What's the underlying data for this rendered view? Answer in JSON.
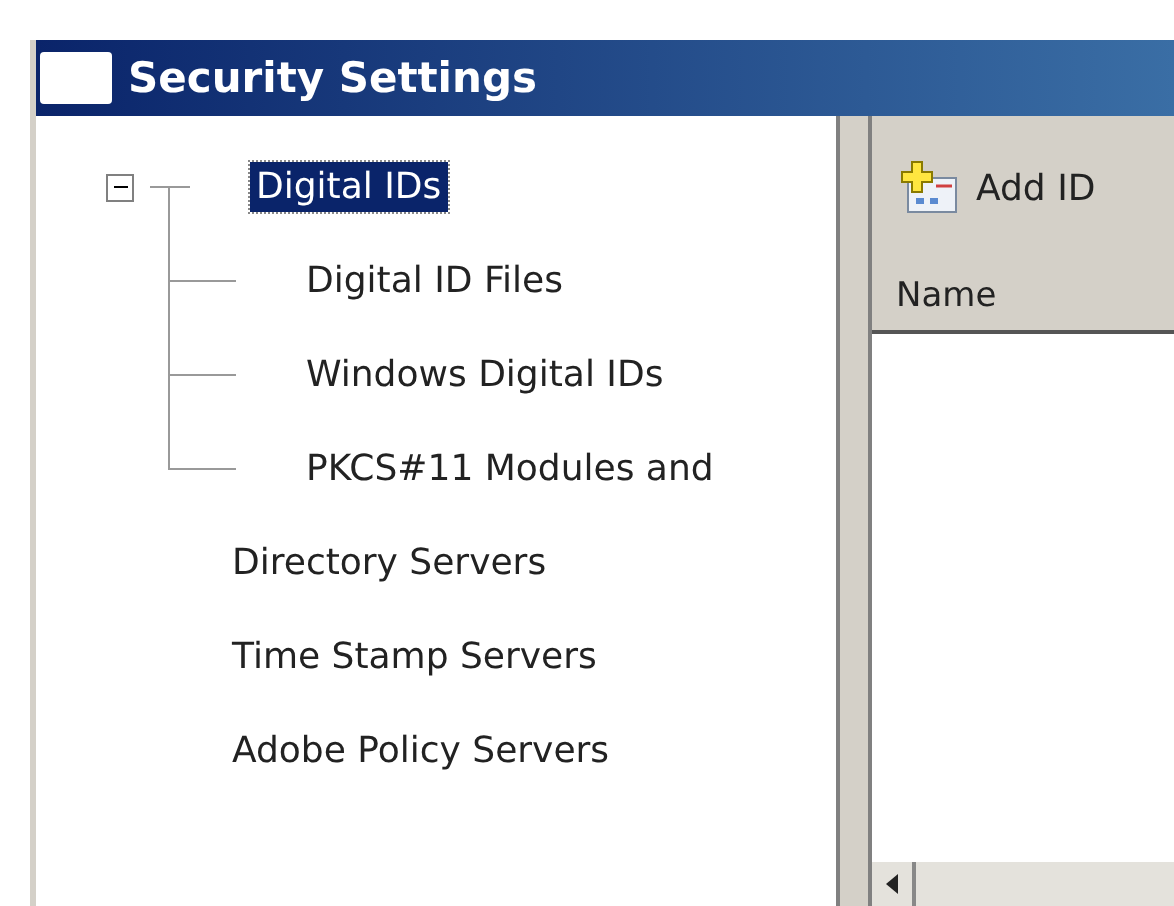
{
  "window": {
    "title": "Security Settings"
  },
  "tree": [
    {
      "label": "Digital IDs",
      "selected": true,
      "expanded": true,
      "children": [
        {
          "label": "Digital ID Files",
          "selected": false
        },
        {
          "label": "Windows Digital IDs",
          "selected": false
        },
        {
          "label": "PKCS#11 Modules and",
          "selected": false
        }
      ]
    },
    {
      "label": "Directory Servers",
      "selected": false
    },
    {
      "label": "Time Stamp Servers",
      "selected": false
    },
    {
      "label": "Adobe Policy Servers",
      "selected": false
    }
  ],
  "toolbar": {
    "add_button": "Add ID"
  },
  "list": {
    "columns": [
      "Name"
    ]
  }
}
